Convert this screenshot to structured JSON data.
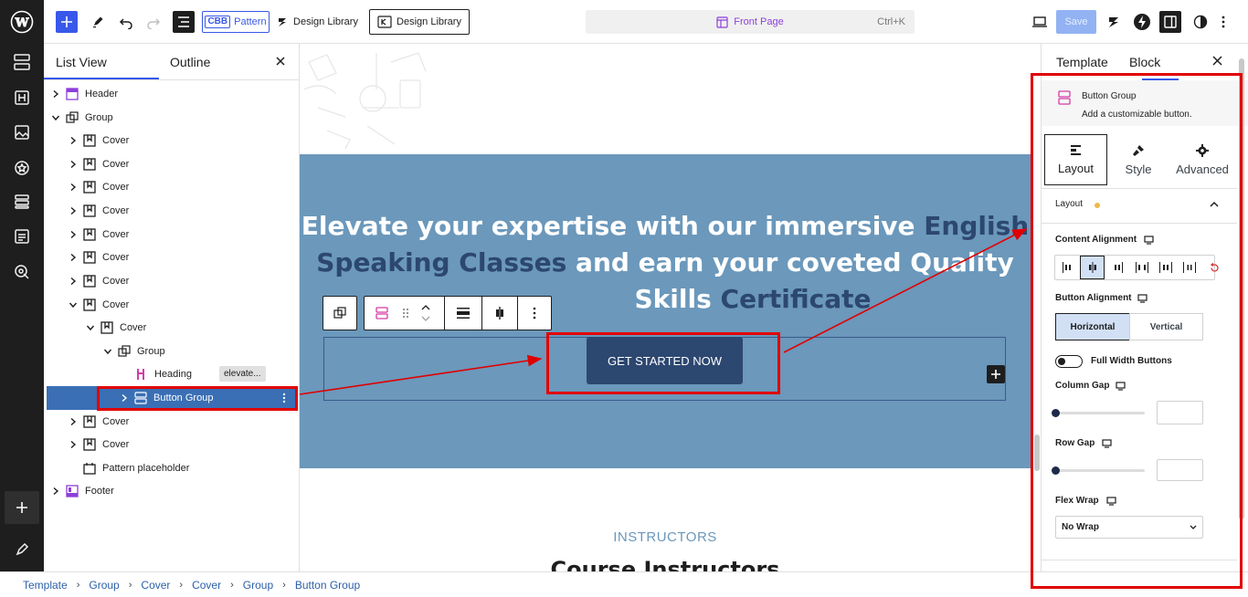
{
  "topbar": {
    "pattern_label": "Pattern",
    "pattern_badge": "CBB",
    "design_library_1": "Design Library",
    "design_library_2": "Design Library",
    "command_label": "Front Page",
    "command_shortcut": "Ctrl+K",
    "save_label": "Save"
  },
  "listview": {
    "tab_list": "List View",
    "tab_outline": "Outline",
    "rows": [
      {
        "label": "Header"
      },
      {
        "label": "Group"
      },
      {
        "label": "Cover"
      },
      {
        "label": "Cover"
      },
      {
        "label": "Cover"
      },
      {
        "label": "Cover"
      },
      {
        "label": "Cover"
      },
      {
        "label": "Cover"
      },
      {
        "label": "Cover"
      },
      {
        "label": "Cover"
      },
      {
        "label": "Cover"
      },
      {
        "label": "Group"
      },
      {
        "label": "Heading",
        "badge": "elevate..."
      },
      {
        "label": "Button Group"
      },
      {
        "label": "Cover"
      },
      {
        "label": "Cover"
      },
      {
        "label": "Pattern placeholder"
      },
      {
        "label": "Footer"
      }
    ]
  },
  "canvas": {
    "hero_line1_a": "Elevate your expertise with our immersive ",
    "hero_line1_b": "English",
    "hero_line2_a": "Speaking Classes",
    "hero_line2_b": " and earn your coveted Quality",
    "hero_line3_a": "Skills ",
    "hero_line3_b": "Certificate",
    "button_label": "GET STARTED NOW",
    "instructors_label": "INSTRUCTORS",
    "instructors_title": "Course Instructors"
  },
  "sidebar": {
    "tab_template": "Template",
    "tab_block": "Block",
    "block_name": "Button Group",
    "block_desc": "Add a customizable button.",
    "tabs": [
      "Layout",
      "Style",
      "Advanced"
    ],
    "section_title": "Layout",
    "content_alignment": "Content Alignment",
    "button_alignment": "Button Alignment",
    "horizontal": "Horizontal",
    "vertical": "Vertical",
    "full_width": "Full Width Buttons",
    "column_gap": "Column Gap",
    "row_gap": "Row Gap",
    "flex_wrap": "Flex Wrap",
    "flex_wrap_value": "No Wrap"
  },
  "breadcrumb": [
    "Template",
    "Group",
    "Cover",
    "Cover",
    "Group",
    "Button Group"
  ],
  "colors": {
    "accent": "#3858e9",
    "hero_bg": "#6b98bb",
    "highlight_text": "#2c4770",
    "button_bg": "#2c4770",
    "selected_row": "#3a6fb5",
    "annotation_red": "#e10000"
  }
}
